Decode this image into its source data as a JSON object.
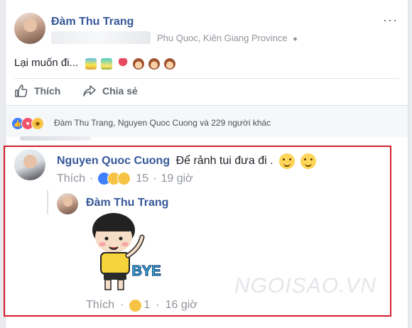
{
  "post": {
    "author": "Đàm Thu Trang",
    "location": "Phu Quoc, Kiên Giang Province",
    "privacy_icon": "globe-icon",
    "text": "Lại muốn đi...",
    "emoji_icons": [
      "photo-icon",
      "photo-icon",
      "umbrella-icon",
      "monkey-icon",
      "monkey-icon",
      "monkey-icon"
    ]
  },
  "actions": {
    "like_label": "Thích",
    "share_label": "Chia sẻ"
  },
  "reactions": {
    "icons": [
      "like-icon",
      "love-icon",
      "haha-icon"
    ],
    "summary": "Đàm Thu Trang, Nguyen Quoc Cuong và 229 người khác"
  },
  "comment": {
    "author": "Nguyen Quoc Cuong",
    "text": "Để rảnh tui đưa đi .",
    "like_label": "Thích",
    "reaction_count": "15",
    "time": "19 giờ"
  },
  "reply": {
    "author": "Đàm Thu Trang",
    "sticker_text": "BYE",
    "like_label": "Thích",
    "reaction_count": "1",
    "time": "16 giờ"
  },
  "watermark": "NGOISAO.VN",
  "colors": {
    "link": "#365899",
    "highlight_frame": "#d61f2c",
    "muted": "#90949c"
  }
}
